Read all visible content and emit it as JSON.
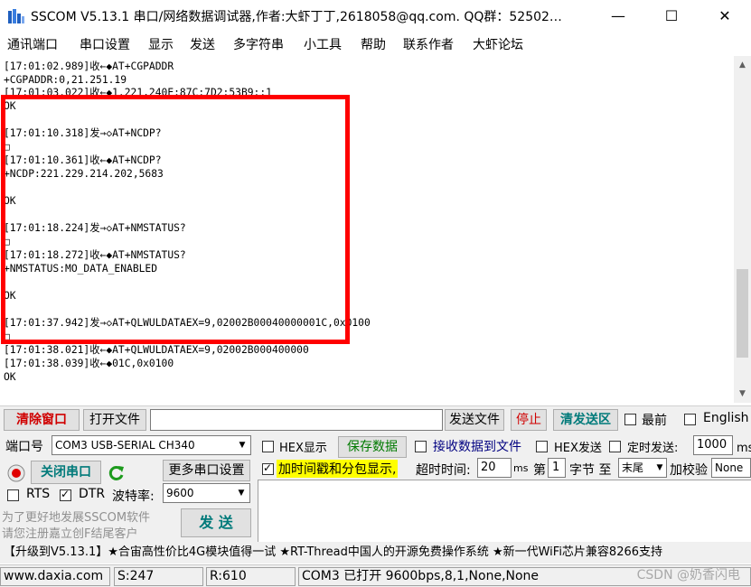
{
  "window": {
    "title": "SSCOM V5.13.1 串口/网络数据调试器,作者:大虾丁丁,2618058@qq.com. QQ群：52502…",
    "buttons": {
      "minimize": "—",
      "maximize": "☐",
      "close": "✕"
    }
  },
  "menu": [
    "通讯端口",
    "串口设置",
    "显示",
    "发送",
    "多字符串",
    "小工具",
    "帮助",
    "联系作者",
    "大虾论坛"
  ],
  "log": [
    "[17:01:02.989]收←◆AT+CGPADDR",
    "+CGPADDR:0,21.251.19",
    "[17:01:03.022]收←◆1.221,240E:87C:7D2:53B9::1",
    "OK",
    "",
    "[17:01:10.318]发→◇AT+NCDP?",
    "□",
    "[17:01:10.361]收←◆AT+NCDP?",
    "+NCDP:221.229.214.202,5683",
    "",
    "OK",
    "",
    "[17:01:18.224]发→◇AT+NMSTATUS?",
    "□",
    "[17:01:18.272]收←◆AT+NMSTATUS?",
    "+NMSTATUS:MO_DATA_ENABLED",
    "",
    "OK",
    "",
    "[17:01:37.942]发→◇AT+QLWULDATAEX=9,02002B00040000001C,0x0100",
    "□",
    "[17:01:38.021]收←◆AT+QLWULDATAEX=9,02002B000400000",
    "[17:01:38.039]收←◆01C,0x0100",
    "OK"
  ],
  "toolbar": {
    "clear_window": "清除窗口",
    "open_file": "打开文件",
    "send_file": "发送文件",
    "stop": "停止",
    "clear_send": "清发送区",
    "topmost": "最前",
    "english": "English"
  },
  "port": {
    "label": "端口号",
    "value": "COM3 USB-SERIAL CH340",
    "close_port": "关闭串口",
    "more_settings": "更多串口设置",
    "rts": "RTS",
    "dtr": "DTR",
    "baud_label": "波特率:",
    "baud_value": "9600"
  },
  "options": {
    "hex_display": "HEX显示",
    "save_data": "保存数据",
    "recv_to_file": "接收数据到文件",
    "hex_send": "HEX发送",
    "timed_send": "定时发送:",
    "interval": "1000",
    "interval_unit": "ms/次",
    "timestamp": "加时间戳和分包显示,",
    "timeout_label": "超时时间:",
    "timeout_value": "20",
    "timeout_unit": "ms",
    "byte_label_pre": "第",
    "byte_value": "1",
    "byte_label_mid": "字节 至",
    "byte_end": "末尾",
    "checksum_label": "加校验",
    "checksum_value": "None"
  },
  "promo": {
    "line1": "为了更好地发展SSCOM软件",
    "line2": "请您注册嘉立创F结尾客户",
    "send": "发 送"
  },
  "ticker": "【升级到V5.13.1】★合宙高性价比4G模块值得一试 ★RT-Thread中国人的开源免费操作系统 ★新一代WiFi芯片兼容8266支持",
  "status": {
    "website": "www.daxia.com",
    "sent": "S:247",
    "received": "R:610",
    "port_state": "COM3 已打开  9600bps,8,1,None,None"
  },
  "watermark": "CSDN @奶香闪电"
}
